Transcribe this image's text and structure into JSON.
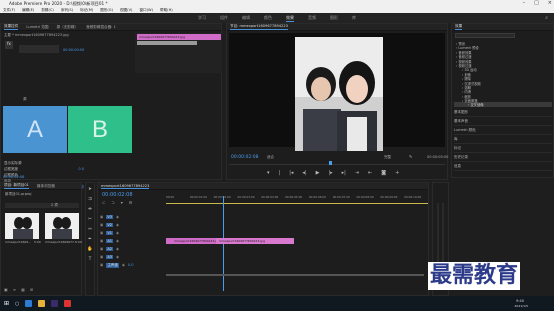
{
  "window": {
    "title": "Adobe Premiere Pro 2020 - D:\\视频\\0\\新项目01 *"
  },
  "menu": [
    "文件(F)",
    "编辑(E)",
    "剪辑(C)",
    "序列(S)",
    "标记(M)",
    "图形(G)",
    "视图(V)",
    "窗口(W)",
    "帮助(H)"
  ],
  "workspace": {
    "tabs": [
      "学习",
      "组件",
      "编辑",
      "颜色",
      "效果",
      "音频",
      "图形",
      "库"
    ],
    "active": "效果"
  },
  "effect_controls": {
    "tabs": [
      "效果控件",
      "Lumetri 范围",
      "源（无剪辑）",
      "音频剪辑混合器: 1"
    ],
    "master_label": "主要 * mmexport1609677894223.jpg",
    "clip_label": "mmexport1609677894223 * mmexport...",
    "section": "视频",
    "clip_name": "mmexport1609677894223.jpg",
    "time_a": "00:00:00:00",
    "source_label": "源",
    "a_label": "A",
    "b_label": "B",
    "timecode": "00:00:00:00",
    "props": [
      "显示实际源",
      "边框宽度",
      "边框颜色",
      "反向",
      "消除锯齿品质"
    ],
    "prop_values": [
      "",
      "0.0",
      "",
      "",
      "中"
    ],
    "bottom_time": "00:00:02:08"
  },
  "program": {
    "tab": "节目: mmexport1609677894223",
    "timecode": "00:00:02:08",
    "fit": "适合",
    "quality": "完整",
    "duration": "00:00:05:00"
  },
  "effects_panel": {
    "title": "效果",
    "search_placeholder": "",
    "items": [
      "预设",
      "Lumetri 预设",
      "音频效果",
      "音频过渡",
      "视频效果",
      "视频过渡",
      "3D 运动",
      "划像",
      "擦除",
      "沉浸式视频",
      "溶解",
      "内滑",
      "缩放",
      "页面剥落",
      "交叉划像"
    ],
    "footer": [
      "基本图形",
      "基本声音",
      "Lumetri 颜色",
      "库",
      "标记",
      "历史记录",
      "信息"
    ]
  },
  "project": {
    "tabs": [
      "项目: 新项目01",
      "媒体浏览器"
    ],
    "file": "新项目01.prproj",
    "count": "2 项",
    "items": [
      {
        "name": "mmexport1609...",
        "dur": "5:00"
      },
      {
        "name": "mmexport1609677...",
        "dur": "5:00"
      }
    ]
  },
  "timeline": {
    "tab": "mmexport1609677894223",
    "timecode": "00:00:02:08",
    "ruler": [
      "00:00",
      "00:00:01:00",
      "00:00:02:00",
      "00:00:03:00",
      "00:00:04:00",
      "00:00:05:00",
      "00:00:06:00",
      "00:00:07:00",
      "00:00:08:00",
      "00:00:09:00",
      "00:00:10:00"
    ],
    "tracks": [
      "V3",
      "V2",
      "V1",
      "A1",
      "A2",
      "A3",
      "主声道"
    ],
    "master_value": "0.0",
    "clip_label": "mmexport1609677894223.jpg",
    "clip_label2": "mmexport1609677894223.jpg"
  },
  "watermark": "最需教育",
  "taskbar": {
    "time": "9:40",
    "date": "2021/1/5"
  },
  "colors": {
    "accent": "#4a8fd9",
    "clip": "#d06cc8",
    "a_panel": "#4b94d2",
    "b_panel": "#2fbf8a"
  }
}
